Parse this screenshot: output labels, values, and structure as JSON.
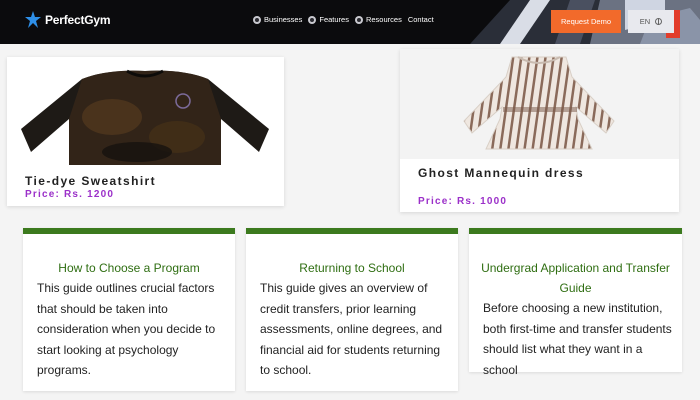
{
  "brand": {
    "name": "PerfectGym"
  },
  "nav": {
    "links": [
      "Businesses",
      "Features",
      "Resources",
      "Contact"
    ],
    "cta_label": "Request Demo",
    "lang_label": "EN"
  },
  "products": [
    {
      "name": "Tie-dye Sweatshirt",
      "price": "Price: Rs. 1200"
    },
    {
      "name": "Ghost Mannequin dress",
      "price": "Price: Rs. 1000"
    }
  ],
  "guides": [
    {
      "title": "How to Choose a Program",
      "text": "This guide outlines crucial factors that should be taken into consideration when you decide to start looking at psychology programs."
    },
    {
      "title": "Returning to School",
      "text": "This guide gives an overview of credit transfers, prior learning assessments, online degrees, and financial aid for students returning to school."
    },
    {
      "title": "Undergrad Application and Transfer Guide",
      "text": "Before choosing a new institution, both first-time and transfer students should list what they want in a school"
    }
  ],
  "colors": {
    "accent_orange": "#f26a2b",
    "guide_green": "#3c7a1e",
    "price_purple": "#9b30c9",
    "nav_bg": "#0b0b0d"
  }
}
